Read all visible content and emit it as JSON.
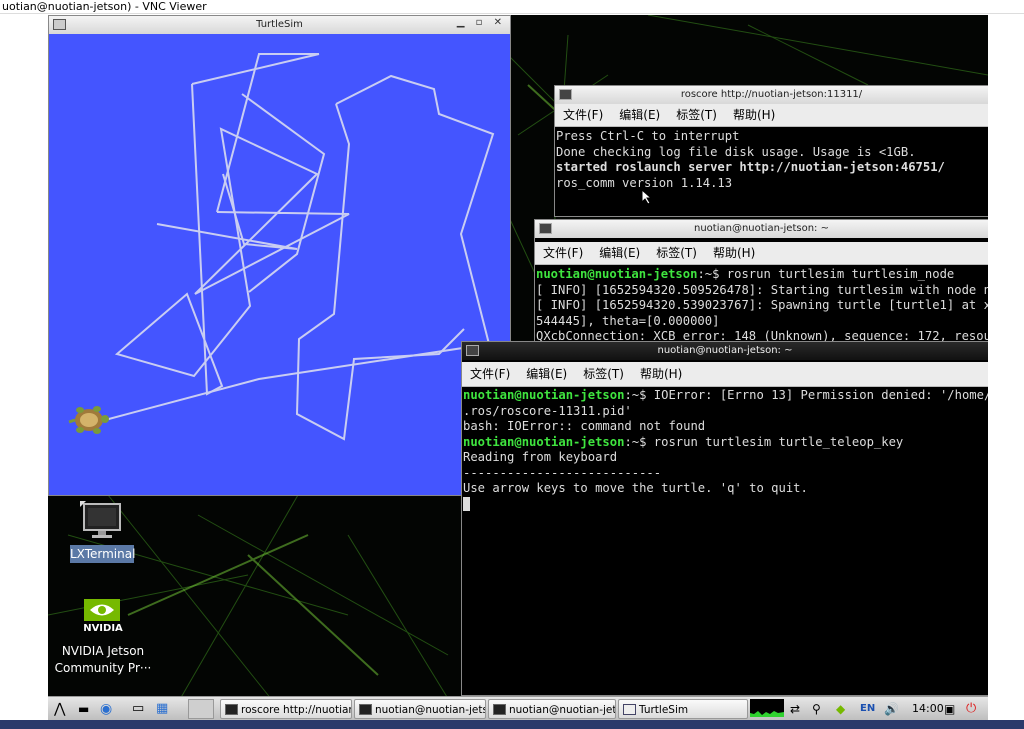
{
  "vnc": {
    "title": "uotian@nuotian-jetson) - VNC Viewer"
  },
  "turtlesim": {
    "title": "TurtleSim",
    "window_buttons": "▁ ▫ ✕",
    "background_color": "#4455ff",
    "path_color": "#c9cdf2"
  },
  "roscore": {
    "title": "roscore http://nuotian-jetson:11311/",
    "menu": [
      "文件(F)",
      "编辑(E)",
      "标签(T)",
      "帮助(H)"
    ],
    "lines": [
      "Press Ctrl-C to interrupt",
      "Done checking log file disk usage. Usage is <1GB.",
      "",
      "started roslaunch server http://nuotian-jetson:46751/",
      "ros_comm version 1.14.13"
    ]
  },
  "term2": {
    "title": "nuotian@nuotian-jetson: ~",
    "menu": [
      "文件(F)",
      "编辑(E)",
      "标签(T)",
      "帮助(H)"
    ],
    "prompt_user": "nuotian@nuotian-jetson",
    "prompt_rest": ":~$ ",
    "command": "rosrun turtlesim turtlesim_node",
    "lines": [
      "[ INFO] [1652594320.509526478]: Starting turtlesim with node n",
      "[ INFO] [1652594320.539023767]: Spawning turtle [turtle1] at x",
      "544445], theta=[0.000000]",
      "QXcbConnection: XCB error: 148 (Unknown), sequence: 172, resou"
    ]
  },
  "term3": {
    "title": "nuotian@nuotian-jetson: ~",
    "menu": [
      "文件(F)",
      "编辑(E)",
      "标签(T)",
      "帮助(H)"
    ],
    "prompt_user": "nuotian@nuotian-jetson",
    "prompt_rest": ":~$ ",
    "line1_rest": "IOError: [Errno 13] Permission denied: '/home/",
    "line2": ".ros/roscore-11311.pid'",
    "line3": "bash: IOError:: command not found",
    "command": "rosrun turtlesim turtle_teleop_key",
    "line5": "Reading from keyboard",
    "line6": "---------------------------",
    "line7": "Use arrow keys to move the turtle. 'q' to quit."
  },
  "desktop_icons": [
    {
      "label": "LXTerminal",
      "icon": "monitor-icon"
    },
    {
      "label_line1": "NVIDIA Jetson",
      "label_line2": "Community Pr···",
      "logo_text": "NVIDIA",
      "icon": "nvidia-logo-icon"
    }
  ],
  "taskbar": {
    "tasks": [
      {
        "label": "roscore http://nuotian···",
        "icon": "terminal-icon"
      },
      {
        "label": "nuotian@nuotian-jets···",
        "icon": "terminal-icon"
      },
      {
        "label": "nuotian@nuotian-jets···",
        "icon": "terminal-icon"
      },
      {
        "label": "TurtleSim",
        "icon": "window-icon"
      }
    ],
    "lang": "EN",
    "clock": "14:00"
  }
}
